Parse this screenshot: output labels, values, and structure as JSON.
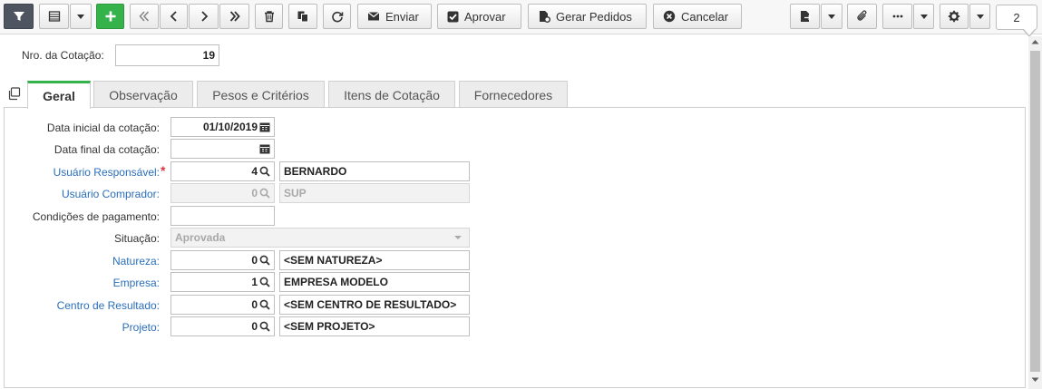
{
  "toolbar": {
    "enviar_label": "Enviar",
    "aprovar_label": "Aprovar",
    "gerar_pedidos_label": "Gerar Pedidos",
    "cancelar_label": "Cancelar",
    "record_count": "2"
  },
  "header": {
    "cotacao_label": "Nro. da Cotação:",
    "cotacao_value": "19"
  },
  "tabs": [
    {
      "label": "Geral"
    },
    {
      "label": "Observação"
    },
    {
      "label": "Pesos e Critérios"
    },
    {
      "label": "Itens de Cotação"
    },
    {
      "label": "Fornecedores"
    }
  ],
  "form": {
    "data_inicial": {
      "label": "Data inicial da cotação:",
      "value": "01/10/2019"
    },
    "data_final": {
      "label": "Data final da cotação:",
      "value": ""
    },
    "usuario_responsavel": {
      "label": "Usuário Responsável:",
      "code": "4",
      "name": "BERNARDO"
    },
    "usuario_comprador": {
      "label": "Usuário Comprador:",
      "code": "0",
      "name": "SUP"
    },
    "condicoes": {
      "label": "Condições de pagamento:",
      "value": ""
    },
    "situacao": {
      "label": "Situação:",
      "value": "Aprovada"
    },
    "natureza": {
      "label": "Natureza:",
      "code": "0",
      "name": "<SEM NATUREZA>"
    },
    "empresa": {
      "label": "Empresa:",
      "code": "1",
      "name": "EMPRESA MODELO"
    },
    "centro": {
      "label": "Centro de Resultado:",
      "code": "0",
      "name": "<SEM CENTRO DE RESULTADO>"
    },
    "projeto": {
      "label": "Projeto:",
      "code": "0",
      "name": "<SEM PROJETO>"
    }
  },
  "colors": {
    "accent_green": "#36b24a",
    "link_blue": "#2a6ebb",
    "required_red": "#d9363e"
  }
}
